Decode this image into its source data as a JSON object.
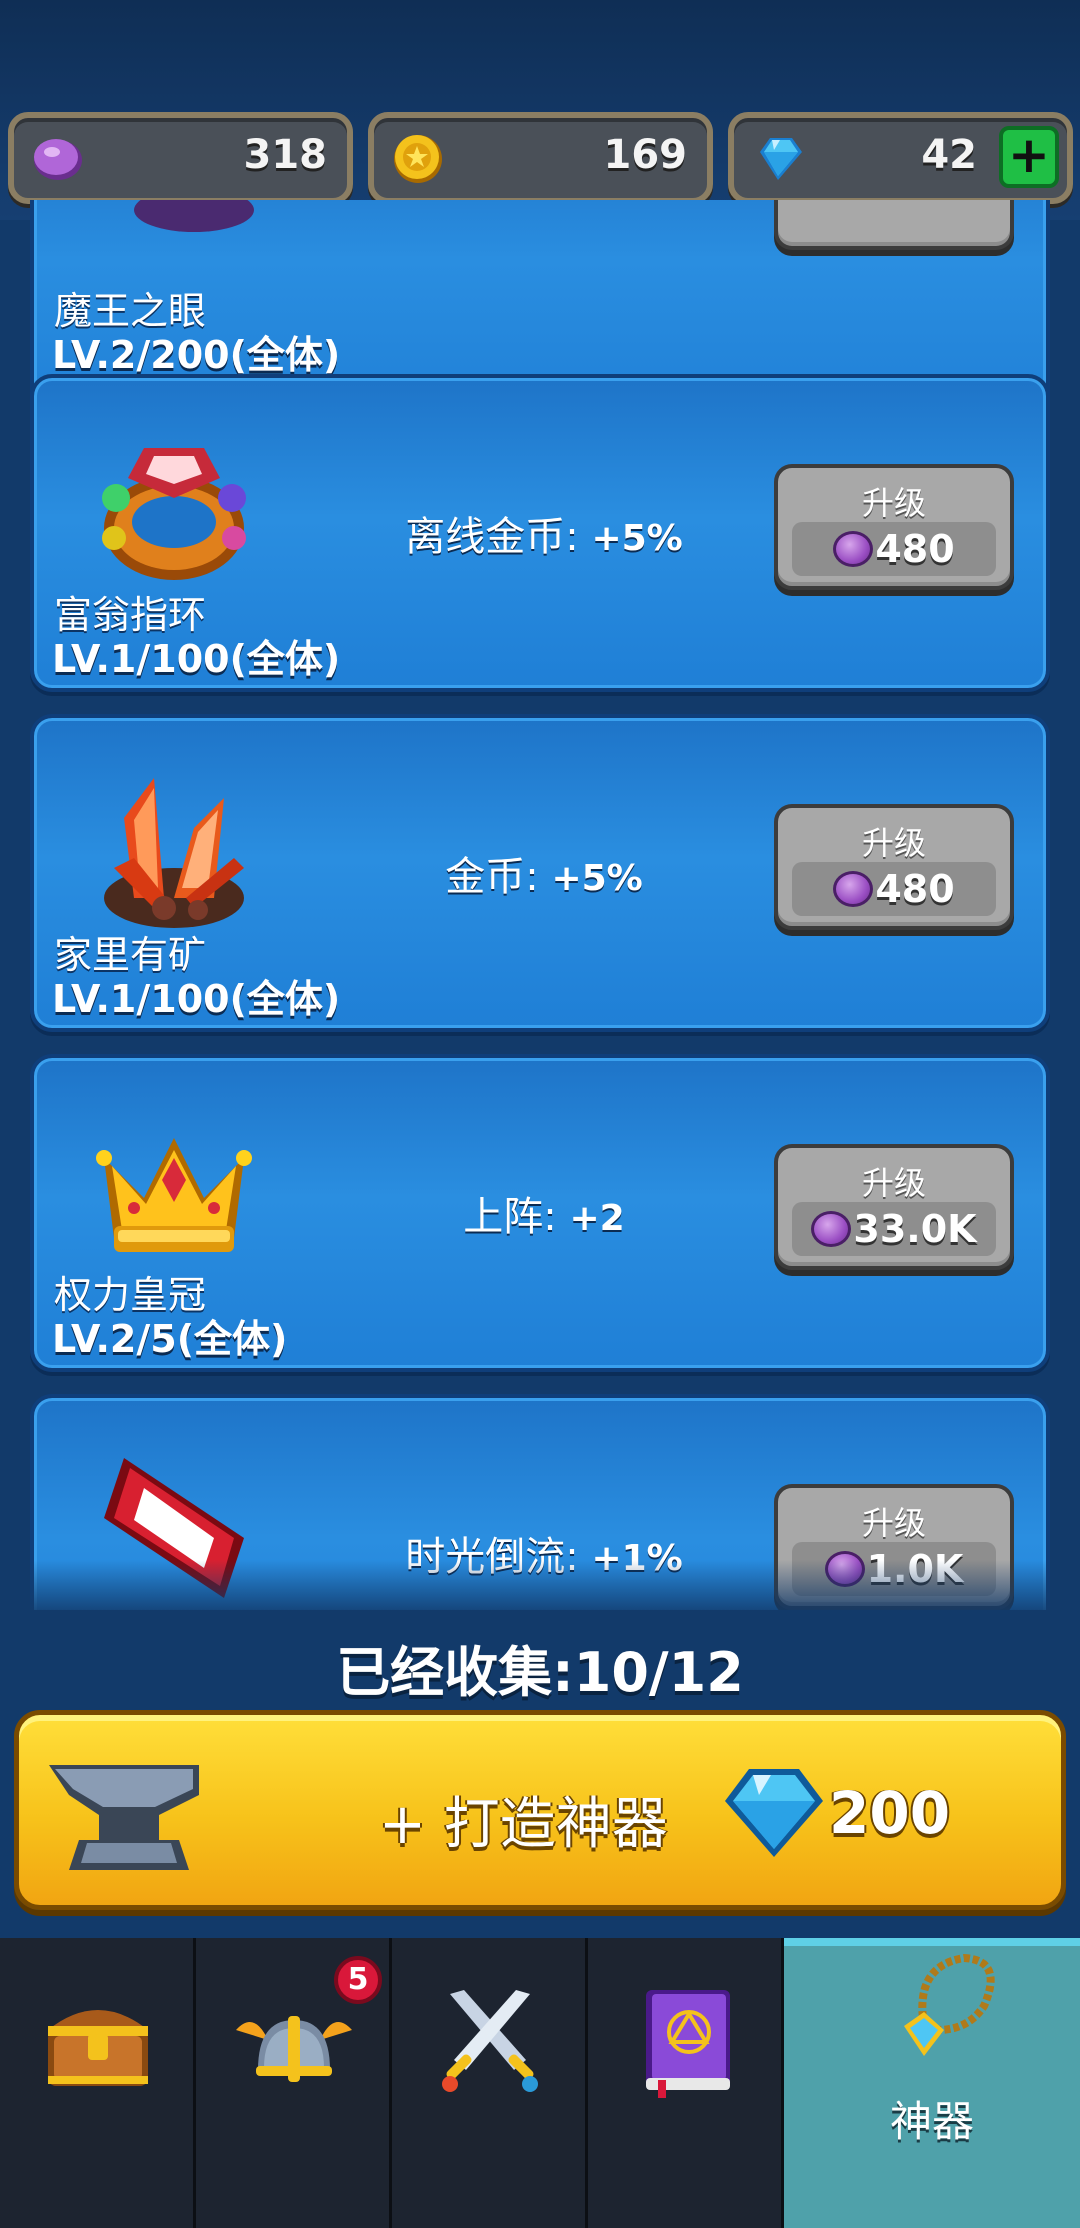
{
  "currencies": [
    {
      "icon": "purple-gem-icon",
      "value": "318"
    },
    {
      "icon": "gold-coin-icon",
      "value": "169"
    },
    {
      "icon": "diamond-icon",
      "value": "42"
    }
  ],
  "artifacts": [
    {
      "name": "魔王之眼",
      "level": "LV.2/200(全体)",
      "effect_label": "",
      "effect_value": "",
      "upgrade_label": "",
      "cost": ""
    },
    {
      "name": "富翁指环",
      "level": "LV.1/100(全体)",
      "effect_label": "离线金币: ",
      "effect_value": "+5%",
      "upgrade_label": "升级",
      "cost": "480"
    },
    {
      "name": "家里有矿",
      "level": "LV.1/100(全体)",
      "effect_label": "金币: ",
      "effect_value": "+5%",
      "upgrade_label": "升级",
      "cost": "480"
    },
    {
      "name": "权力皇冠",
      "level": "LV.2/5(全体)",
      "effect_label": "上阵: ",
      "effect_value": "+2",
      "upgrade_label": "升级",
      "cost": "33.0K"
    },
    {
      "name": "",
      "level": "",
      "effect_label": "时光倒流: ",
      "effect_value": "+1%",
      "upgrade_label": "升级",
      "cost": "1.0K"
    }
  ],
  "collected": "已经收集:10/12",
  "forge": {
    "label": "+ 打造神器",
    "cost": "200"
  },
  "nav": {
    "tabs": [
      {
        "icon": "treasure-chest-icon",
        "label": ""
      },
      {
        "icon": "winged-helmet-icon",
        "label": "",
        "badge": "5"
      },
      {
        "icon": "crossed-swords-icon",
        "label": ""
      },
      {
        "icon": "spellbook-icon",
        "label": ""
      },
      {
        "icon": "amulet-icon",
        "label": "神器"
      }
    ]
  },
  "colors": {
    "card_blue": "#2a8ee0",
    "forge_yellow": "#f7c21a",
    "active_tab": "#4fa1aa",
    "badge_red": "#d9183a"
  }
}
